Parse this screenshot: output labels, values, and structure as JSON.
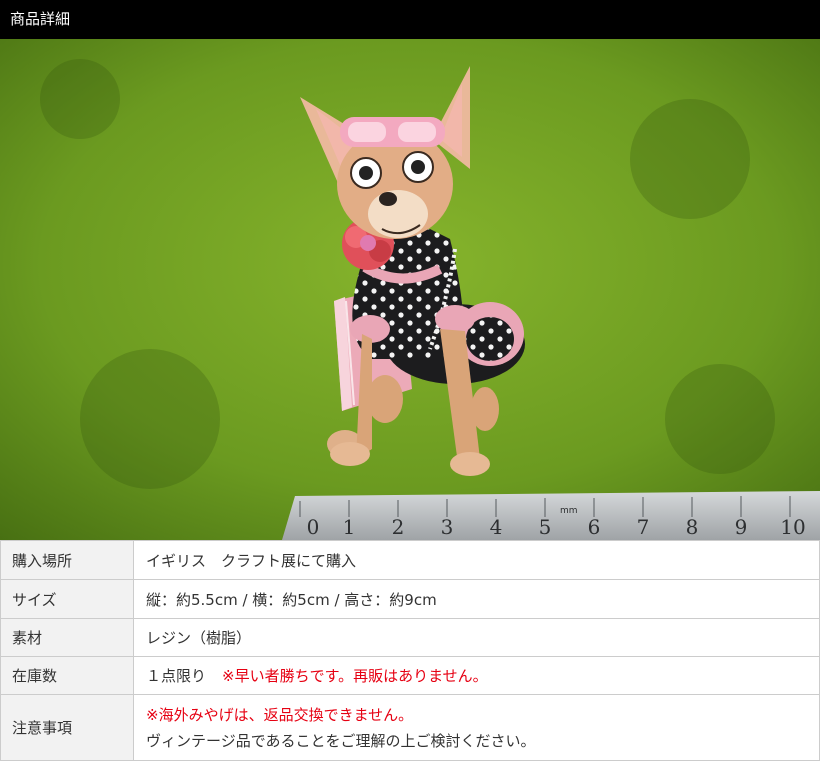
{
  "header": {
    "title": "商品詳細"
  },
  "photo": {
    "subject": "chihuahua-figurine",
    "colors": {
      "grass": "#5f8e1b",
      "ruler": "#b9bcbe",
      "dress": "#1c1c1e",
      "pink": "#e9a6b6"
    },
    "ruler_labels": [
      "0",
      "1",
      "2",
      "3",
      "4",
      "5",
      "6",
      "7",
      "8",
      "9",
      "10"
    ],
    "ruler_unit": "mm"
  },
  "specs": {
    "rows": [
      {
        "label": "購入場所",
        "value": "イギリス　クラフト展にて購入"
      },
      {
        "label": "サイズ",
        "value": "縦：約5.5cm / 横：約5cm / 高さ：約9cm"
      },
      {
        "label": "素材",
        "value": "レジン（樹脂）"
      },
      {
        "label": "在庫数",
        "value": "１点限り",
        "note": "※早い者勝ちです。再販はありません。"
      },
      {
        "label": "注意事項",
        "note": "※海外みやげは、返品交換できません。",
        "value": "ヴィンテージ品であることをご理解の上ご検討ください。"
      }
    ]
  },
  "colors": {
    "header_bg": "#000000",
    "label_bg": "#f2f2f2",
    "border": "#cccccc",
    "note_red": "#e60012"
  }
}
